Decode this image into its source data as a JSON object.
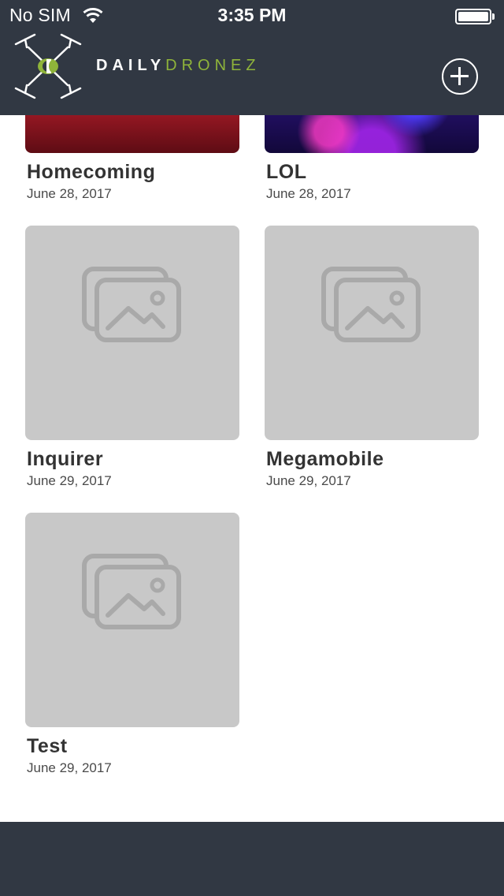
{
  "status_bar": {
    "carrier": "No SIM",
    "time": "3:35 PM"
  },
  "nav": {
    "logo_daily": "DAILY",
    "logo_dronez": "DRONEZ",
    "add_icon": "plus-circle-icon",
    "colors": {
      "bar": "#313843",
      "accent": "#8fb43a"
    }
  },
  "albums": [
    {
      "title": "Homecoming",
      "date": "June 28, 2017",
      "thumb": "photo"
    },
    {
      "title": "LOL",
      "date": "June 28, 2017",
      "thumb": "photo"
    },
    {
      "title": "Inquirer",
      "date": "June 29, 2017",
      "thumb": "image-placeholder-icon"
    },
    {
      "title": "Megamobile",
      "date": "June 29, 2017",
      "thumb": "image-placeholder-icon"
    },
    {
      "title": "Test",
      "date": "June 29, 2017",
      "thumb": "image-placeholder-icon"
    }
  ]
}
